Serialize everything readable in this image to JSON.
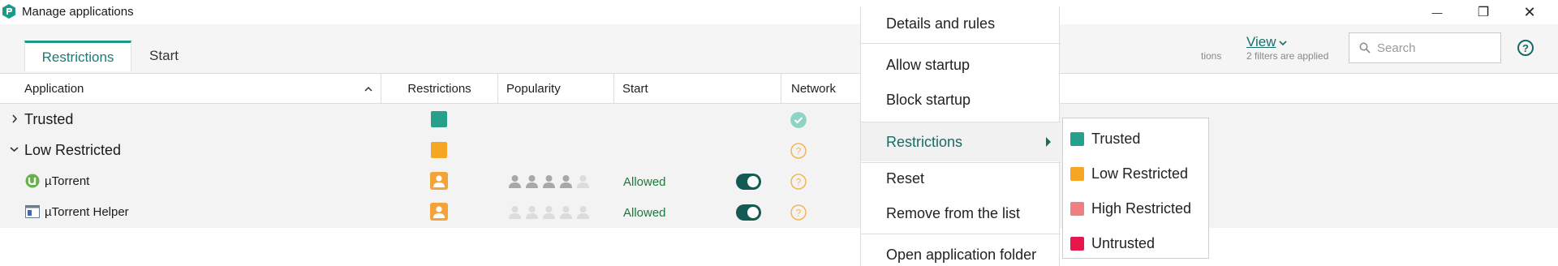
{
  "window": {
    "title": "Manage applications",
    "min_glyph": "—",
    "max_glyph": "❐",
    "close_glyph": "✕"
  },
  "tabs": [
    {
      "label": "Restrictions",
      "active": true
    },
    {
      "label": "Start",
      "active": false
    }
  ],
  "toolbar": {
    "filter_note_fragment": "tions",
    "filter_note": "2 filters are applied",
    "view_label": "View",
    "search_placeholder": "Search",
    "help_glyph": "?"
  },
  "table": {
    "columns": [
      "Application",
      "Restrictions",
      "Popularity",
      "Start",
      "Network"
    ],
    "groups": [
      {
        "label": "Trusted",
        "color": "#26a08b",
        "network": "trusted-check"
      },
      {
        "label": "Low Restricted",
        "color": "#f5a623",
        "network": "unknown"
      }
    ],
    "apps": [
      {
        "label": "µTorrent",
        "start": "Allowed",
        "popularity": 4,
        "enabled": true
      },
      {
        "label": "µTorrent Helper",
        "start": "Allowed",
        "popularity": 0,
        "enabled": true
      }
    ]
  },
  "context_menu": {
    "items": [
      "Details and rules",
      "Allow startup",
      "Block startup",
      "Restrictions",
      "Reset",
      "Remove from the list",
      "Open application folder"
    ]
  },
  "submenu": {
    "items": [
      {
        "label": "Trusted",
        "color": "#26a08b"
      },
      {
        "label": "Low Restricted",
        "color": "#f5a623"
      },
      {
        "label": "High Restricted",
        "color": "#ee8080"
      },
      {
        "label": "Untrusted",
        "color": "#e8174b"
      }
    ]
  },
  "colors": {
    "accent": "#1b9a8a",
    "link": "#1a6d6a",
    "allowed": "#1a7a3a",
    "toggle_on": "#135b52"
  }
}
